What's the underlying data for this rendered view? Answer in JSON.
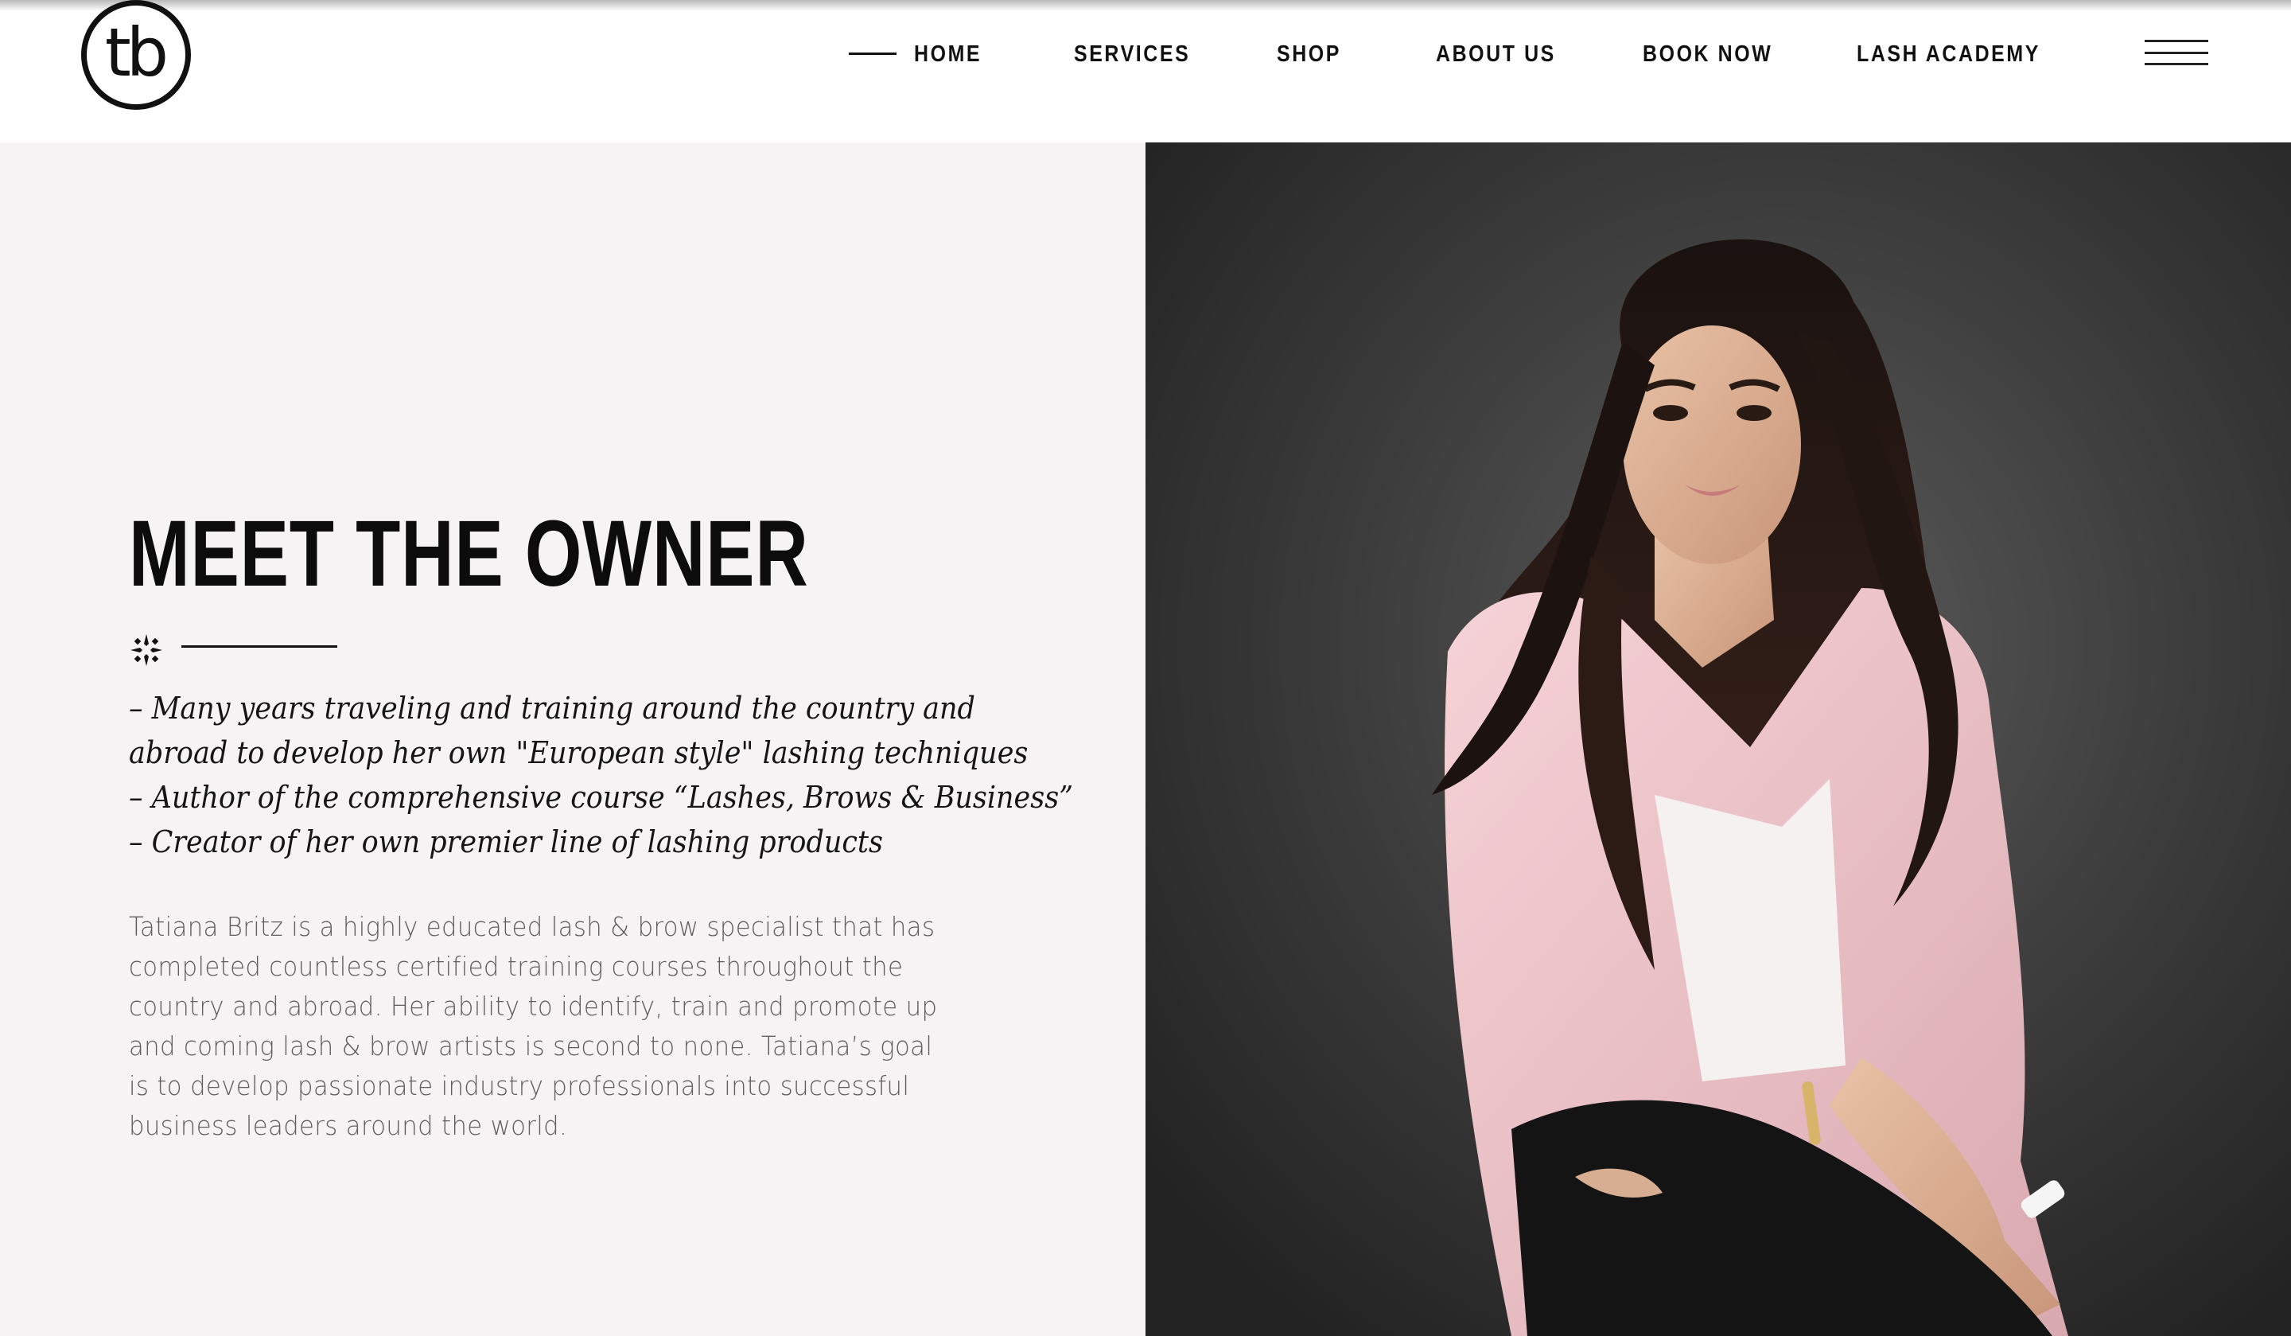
{
  "header": {
    "logo_text": "tb",
    "nav": {
      "home": "HOME",
      "services": "SERVICES",
      "shop": "SHOP",
      "about": "ABOUT US",
      "book": "BOOK NOW",
      "academy": "LASH ACADEMY"
    },
    "menu_icon": "hamburger-menu-icon"
  },
  "main": {
    "title": "MEET THE OWNER",
    "ornament_icon": "sparkle-icon",
    "bullets": [
      "– Many years traveling and training around the country and",
      "abroad to develop her own \"European style\" lashing techniques",
      "– Author of the comprehensive course “Lashes, Brows & Business”",
      "– Creator of her own premier line of lashing products"
    ],
    "body": [
      "Tatiana Britz is a highly educated lash & brow specialist that has",
      "completed countless certified training courses throughout the",
      "country and abroad. Her ability to identify, train and promote up",
      "and coming lash & brow artists is second to none. Tatiana’s goal",
      "is to develop passionate industry professionals into successful",
      "business leaders around the world."
    ]
  },
  "colors": {
    "panel_bg": "#f5f3f4",
    "text_dark": "#111111",
    "text_body": "#5e5e5e",
    "photo_bg": "#3a3a3a",
    "blazer": "#f2c9cf"
  }
}
